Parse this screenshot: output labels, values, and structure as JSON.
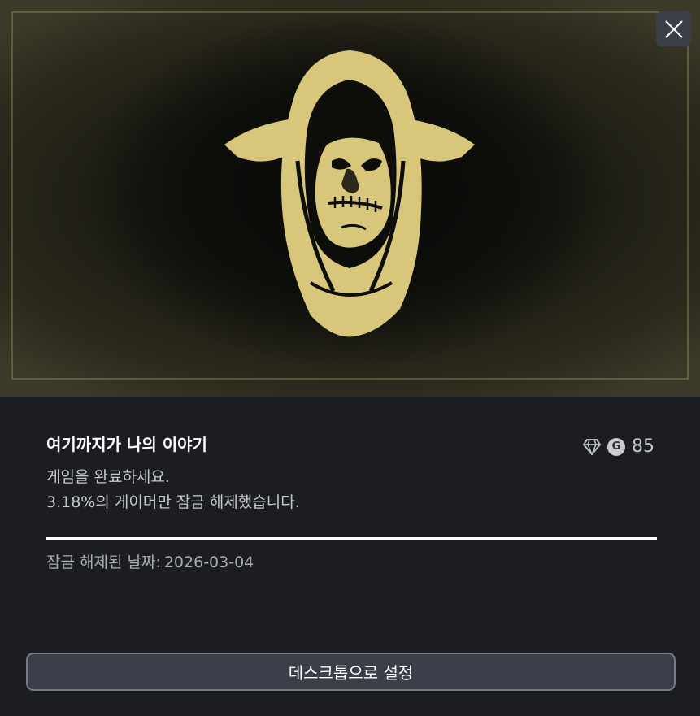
{
  "achievement": {
    "title": "여기까지가 나의 이야기",
    "description": "게임을 완료하세요.",
    "rarity_text": "3.18%의 게이머만 잠금 해제했습니다.",
    "gamerscore_badge": "G",
    "gamerscore": "85",
    "progress_percent": 100,
    "unlock_label": "잠금 해제된 날짜:",
    "unlock_date": "2026-03-04"
  },
  "actions": {
    "set_desktop_label": "데스크톱으로 설정"
  },
  "icons": {
    "close": "close-icon",
    "rarity": "diamond-icon",
    "emblem": "hooded-goblin-emblem"
  },
  "colors": {
    "emblem_gold": "#d8c77a",
    "panel_bg": "#1b1d22",
    "button_bg": "#3a3f4a"
  }
}
